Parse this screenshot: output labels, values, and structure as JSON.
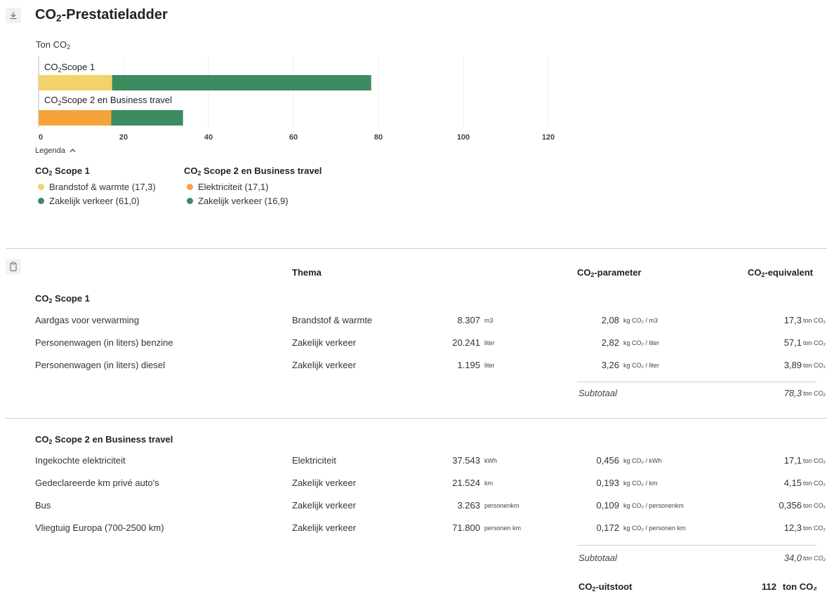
{
  "title": "CO₂-Prestatieladder",
  "icons": {
    "download": "download-icon",
    "clipboard": "clipboard-icon",
    "chevron": "chevron-up-icon"
  },
  "chart_data": {
    "type": "bar",
    "orientation": "horizontal",
    "stacked": true,
    "ylabel": "Ton CO₂",
    "xlim": [
      0,
      135
    ],
    "x_ticks": [
      "0",
      "20",
      "40",
      "60",
      "80",
      "100",
      "120"
    ],
    "grid": true,
    "categories": [
      "CO₂ Scope 1",
      "CO₂ Scope 2 en Business travel"
    ],
    "stacks": [
      {
        "category": "CO₂ Scope 1",
        "segments": [
          {
            "name": "Brandstof & warmte",
            "value": 17.3,
            "color": "#f2d36a"
          },
          {
            "name": "Zakelijk verkeer",
            "value": 61.0,
            "color": "#3d8c5f"
          }
        ]
      },
      {
        "category": "CO₂ Scope 2 en Business travel",
        "segments": [
          {
            "name": "Elektriciteit",
            "value": 17.1,
            "color": "#f6a43a"
          },
          {
            "name": "Zakelijk verkeer",
            "value": 16.9,
            "color": "#3d8c5f"
          }
        ]
      }
    ]
  },
  "legend": {
    "toggle_label": "Legenda",
    "groups": [
      {
        "title": "Scope 1",
        "items": [
          {
            "label": "Brandstof & warmte (17,3)",
            "color": "#f2d36a"
          },
          {
            "label": "Zakelijk verkeer (61,0)",
            "color": "#3d8c5f"
          }
        ]
      },
      {
        "title": "Scope 2 en Business travel",
        "items": [
          {
            "label": "Elektriciteit (17,1)",
            "color": "#f6a43a"
          },
          {
            "label": "Zakelijk verkeer (16,9)",
            "color": "#3d8c5f"
          }
        ]
      }
    ]
  },
  "table": {
    "headers": {
      "thema": "Thema",
      "parameter": "-parameter",
      "equivalent": "-equivalent"
    },
    "sections": [
      {
        "title": "Scope 1",
        "rows": [
          {
            "name": "Aardgas voor verwarming",
            "thema": "Brandstof & warmte",
            "qty": "8.307",
            "unit": "m3",
            "param": "2,08",
            "param_unit": "kg CO₂ / m3",
            "eq": "17,3",
            "eq_unit": "ton CO₂"
          },
          {
            "name": "Personenwagen (in liters) benzine",
            "thema": "Zakelijk verkeer",
            "qty": "20.241",
            "unit": "liter",
            "param": "2,82",
            "param_unit": "kg CO₂ / liter",
            "eq": "57,1",
            "eq_unit": "ton CO₂"
          },
          {
            "name": "Personenwagen (in liters) diesel",
            "thema": "Zakelijk verkeer",
            "qty": "1.195",
            "unit": "liter",
            "param": "3,26",
            "param_unit": "kg CO₂ / liter",
            "eq": "3,89",
            "eq_unit": "ton CO₂"
          }
        ],
        "subtotal_label": "Subtotaal",
        "subtotal": "78,3",
        "subtotal_unit": "ton CO₂"
      },
      {
        "title": "Scope 2 en Business travel",
        "rows": [
          {
            "name": "Ingekochte elektriciteit",
            "thema": "Elektriciteit",
            "qty": "37.543",
            "unit": "kWh",
            "param": "0,456",
            "param_unit": "kg CO₂ / kWh",
            "eq": "17,1",
            "eq_unit": "ton CO₂"
          },
          {
            "name": "Gedeclareerde km privé auto's",
            "thema": "Zakelijk verkeer",
            "qty": "21.524",
            "unit": "km",
            "param": "0,193",
            "param_unit": "kg CO₂ / km",
            "eq": "4,15",
            "eq_unit": "ton CO₂"
          },
          {
            "name": "Bus",
            "thema": "Zakelijk verkeer",
            "qty": "3.263",
            "unit": "personenkm",
            "param": "0,109",
            "param_unit": "kg CO₂ / personenkm",
            "eq": "0,356",
            "eq_unit": "ton CO₂"
          },
          {
            "name": "Vliegtuig Europa (700-2500 km)",
            "thema": "Zakelijk verkeer",
            "qty": "71.800",
            "unit": "personen km",
            "param": "0,172",
            "param_unit": "kg CO₂ / personen km",
            "eq": "12,3",
            "eq_unit": "ton CO₂"
          }
        ],
        "subtotal_label": "Subtotaal",
        "subtotal": "34,0",
        "subtotal_unit": "ton CO₂"
      }
    ],
    "total_label": "-uitstoot",
    "total": "112",
    "total_unit": "ton CO₂"
  }
}
